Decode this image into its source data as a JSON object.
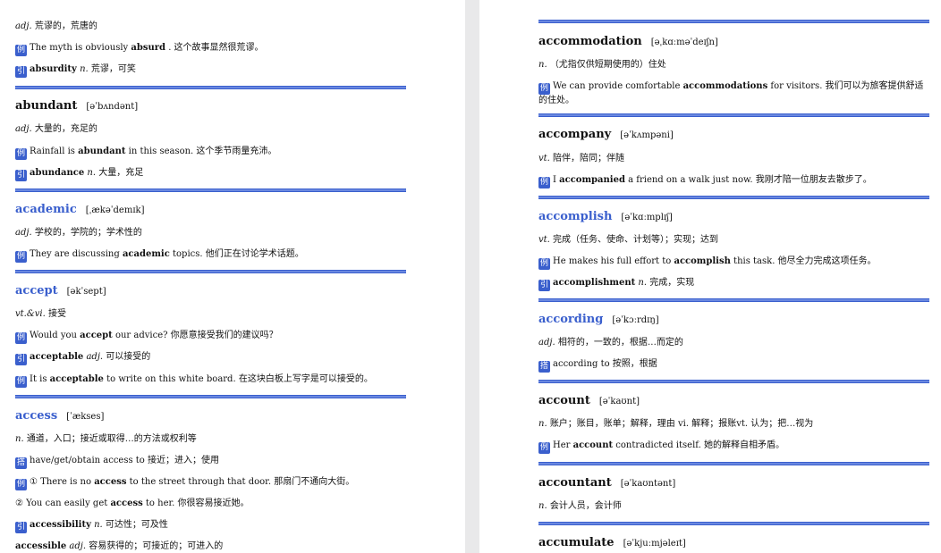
{
  "left": {
    "absurd_tail": {
      "def_pos": "adj.",
      "def": "荒谬的，荒唐的",
      "ex_tag": "例",
      "ex_a": "The myth is obviously ",
      "ex_b": "absurd",
      "ex_c": " . 这个故事显然很荒谬。",
      "der_tag": "引",
      "der_word": "absurdity",
      "der_pos": "n.",
      "der_def": "荒谬，可笑"
    },
    "abundant": {
      "word": "abundant",
      "pron": "[əˈbʌndənt]",
      "def_pos": "adj.",
      "def": "大量的，充足的",
      "ex_tag": "例",
      "ex_a": "Rainfall is ",
      "ex_b": "abundant",
      "ex_c": " in this season. 这个季节雨量充沛。",
      "der_tag": "引",
      "der_word": "abundance",
      "der_pos": "n.",
      "der_def": "大量，充足"
    },
    "academic": {
      "word": "academic",
      "pron": "[ˌækəˈdemɪk]",
      "def_pos": "adj.",
      "def": "学校的，学院的；学术性的",
      "ex_tag": "例",
      "ex_a": "They are discussing ",
      "ex_b": "academic",
      "ex_c": " topics. 他们正在讨论学术话题。"
    },
    "accept": {
      "word": "accept",
      "pron": "[əkˈsept]",
      "def_pos": "vt.&vi.",
      "def": "接受",
      "ex1_tag": "例",
      "ex1_a": "Would you ",
      "ex1_b": "accept",
      "ex1_c": " our advice? 你愿意接受我们的建议吗？",
      "der_tag": "引",
      "der_word": "acceptable",
      "der_pos": "adj.",
      "der_def": "可以接受的",
      "ex2_tag": "例",
      "ex2_a": "It is ",
      "ex2_b": "acceptable",
      "ex2_c": " to write on this white board. 在这块白板上写字是可以接受的。"
    },
    "access": {
      "word": "access",
      "pron": "[ˈækses]",
      "def_pos": "n.",
      "def": "通道，入口；接近或取得…的方法或权利等",
      "col_tag": "搭",
      "col_text": "have/get/obtain access to 接近；进入；使用",
      "ex1_tag": "例",
      "ex1_a": "① There is no ",
      "ex1_b": "access",
      "ex1_c": " to the street through that door. 那扇门不通向大街。",
      "ex2_a": "② You can easily get ",
      "ex2_b": "access",
      "ex2_c": " to her. 你很容易接近她。",
      "der_tag": "引",
      "der_word": "accessibility",
      "der_pos": "n.",
      "der_def": "可达性；可及性",
      "der2_word": "accessible",
      "der2_pos": "adj.",
      "der2_def": "容易获得的；可接近的；可进入的"
    }
  },
  "right": {
    "accommodation": {
      "word": "accommodation",
      "pron": "[əˌkɑːməˈdeɪʃn]",
      "def_pos": "n.",
      "def": "（尤指仅供短期使用的）住处",
      "ex_tag": "例",
      "ex_a": "We can provide comfortable ",
      "ex_b": "accommodations",
      "ex_c": " for visitors. 我们可以为旅客提供舒适的住处。"
    },
    "accompany": {
      "word": "accompany",
      "pron": "[əˈkʌmpəni]",
      "def_pos": "vt.",
      "def": "陪伴，陪同；伴随",
      "ex_tag": "例",
      "ex_a": "I ",
      "ex_b": "accompanied",
      "ex_c": " a friend on a walk just now. 我刚才陪一位朋友去散步了。"
    },
    "accomplish": {
      "word": "accomplish",
      "pron": "[əˈkɑːmplɪʃ]",
      "def_pos": "vt.",
      "def": "完成（任务、使命、计划等）；实现；达到",
      "ex_tag": "例",
      "ex_a": "He makes his full effort to ",
      "ex_b": "accomplish",
      "ex_c": " this task. 他尽全力完成这项任务。",
      "der_tag": "引",
      "der_word": "accomplishment",
      "der_pos": "n.",
      "der_def": "完成，实现"
    },
    "according": {
      "word": "according",
      "pron": "[əˈkɔːrdɪŋ]",
      "def_pos": "adj.",
      "def": "相符的，一致的，根据…而定的",
      "col_tag": "搭",
      "col_text": "according to 按照，根据"
    },
    "account": {
      "word": "account",
      "pron": "[əˈkaʊnt]",
      "def_pos": "n.",
      "def": "账户；账目，账单；解释，理由 vi. 解释；报账vt. 认为；把…视为",
      "ex_tag": "例",
      "ex_a": "Her ",
      "ex_b": "account",
      "ex_c": " contradicted itself. 她的解释自相矛盾。"
    },
    "accountant": {
      "word": "accountant",
      "pron": "[əˈkaʊntənt]",
      "def_pos": "n.",
      "def": "会计人员，会计师"
    },
    "accumulate": {
      "word": "accumulate",
      "pron": "[əˈkjuːmjəleɪt]"
    }
  },
  "colors": {
    "accent": "#3a5fcd",
    "rule": "#6a88e0"
  }
}
